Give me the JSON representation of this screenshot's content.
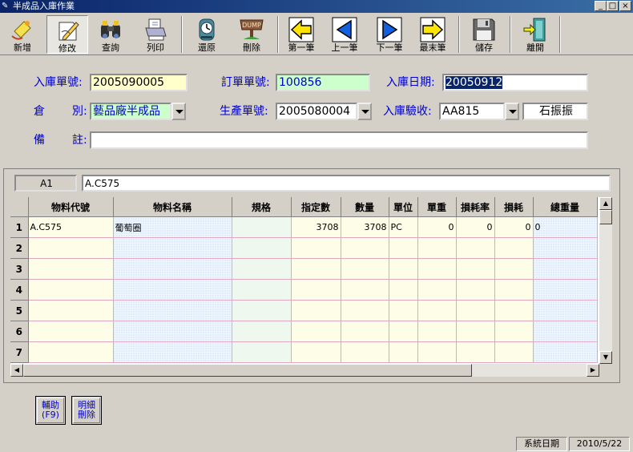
{
  "window": {
    "title": "半成品入庫作業",
    "minimize": "_",
    "maximize": "□",
    "close": "×"
  },
  "toolbar": [
    {
      "label": "新增",
      "icon": "new-document-icon"
    },
    {
      "label": "修改",
      "icon": "edit-pencil-icon"
    },
    {
      "label": "查詢",
      "icon": "binoculars-icon"
    },
    {
      "label": "列印",
      "icon": "printer-icon"
    },
    {
      "label": "還原",
      "icon": "clock-icon"
    },
    {
      "label": "刪除",
      "icon": "dump-sign-icon"
    },
    {
      "label": "第一筆",
      "icon": "arrow-first-icon"
    },
    {
      "label": "上一筆",
      "icon": "arrow-prev-icon"
    },
    {
      "label": "下一筆",
      "icon": "arrow-next-icon"
    },
    {
      "label": "最末筆",
      "icon": "arrow-last-icon"
    },
    {
      "label": "儲存",
      "icon": "floppy-disk-icon"
    },
    {
      "label": "離開",
      "icon": "exit-door-icon"
    }
  ],
  "form": {
    "receipt_no_label": "入庫單號:",
    "receipt_no": "2005090005",
    "order_no_label": "訂單單號:",
    "order_no": "100856",
    "receipt_date_label": "入庫日期:",
    "receipt_date": "20050912",
    "warehouse_label_a": "倉",
    "warehouse_label_b": "別:",
    "warehouse": "藝品廠半成品",
    "production_no_label": "生產單號:",
    "production_no": "2005080004",
    "inspector_label": "入庫驗收:",
    "inspector_code": "AA815",
    "inspector_name": "石振振",
    "remark_label_a": "備",
    "remark_label_b": "註:",
    "remark": ""
  },
  "grid": {
    "cell_ref": "A1",
    "cell_value": "A.C575",
    "columns": [
      "物料代號",
      "物料名稱",
      "規格",
      "指定數",
      "數量",
      "單位",
      "單重",
      "損耗率",
      "損耗",
      "總重量"
    ],
    "row_numbers": [
      "1",
      "2",
      "3",
      "4",
      "5",
      "6",
      "7"
    ],
    "rows": [
      [
        "A.C575",
        "葡萄圈",
        "",
        "3708",
        "3708",
        "PC",
        "0",
        "0",
        "0",
        "0"
      ]
    ]
  },
  "buttons": {
    "assist": "輔助\n(F9)",
    "delete_detail": "明細\n刪除"
  },
  "status": {
    "system_date_label": "系統日期",
    "system_date": "2010/5/22"
  },
  "colors": {
    "titlebar": "#0a246a",
    "label_text": "#0000cc",
    "receipt_no_bg": "#ffffcc",
    "order_no_bg": "#ccffcc",
    "date_selected_bg": "#0a246a"
  }
}
